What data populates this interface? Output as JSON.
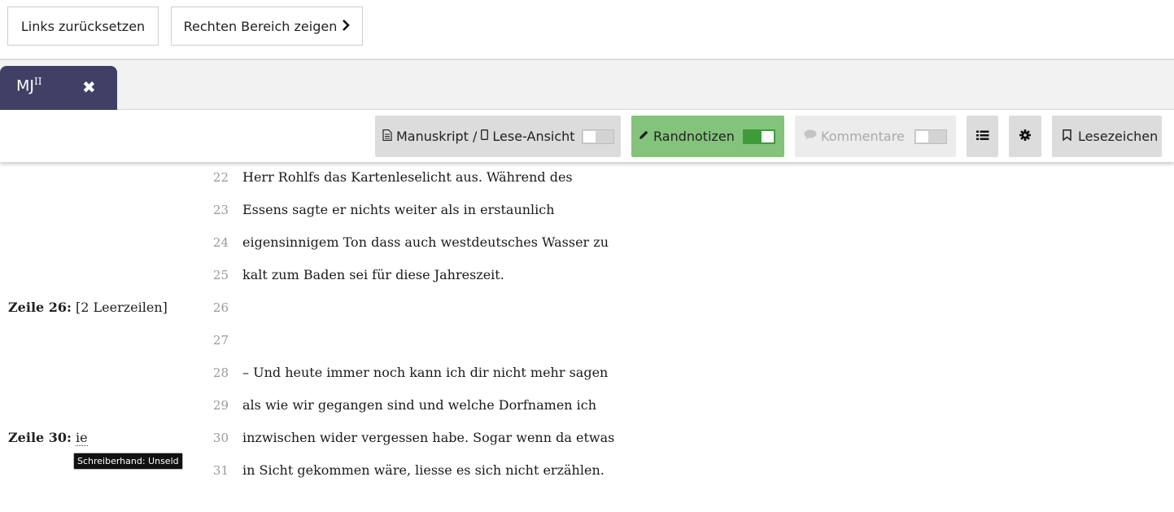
{
  "top_buttons": {
    "reset_left": "Links zurücksetzen",
    "show_right": "Rechten Bereich zeigen"
  },
  "tab": {
    "label": "MJ",
    "sup": "II",
    "close": "✖"
  },
  "toolbar": {
    "view_toggle": {
      "manuscript_label": "Manuskript /",
      "reading_label": "Lese-Ansicht",
      "on": false
    },
    "notes_toggle": {
      "label": "Randnotizen",
      "on": true
    },
    "comments_toggle": {
      "label": "Kommentare",
      "on": false,
      "disabled": true
    },
    "list_icon": "list-icon",
    "settings_icon": "gear-icon",
    "bookmarks_label": "Lesezeichen"
  },
  "lines": [
    {
      "num": "22",
      "text": "Herr Rohlfs das Kartenleselicht aus. Während des",
      "note_label": "",
      "note_text": ""
    },
    {
      "num": "23",
      "text": "Essens sagte er nichts weiter als in erstaunlich",
      "note_label": "",
      "note_text": ""
    },
    {
      "num": "24",
      "text": "eigensinnigem Ton dass auch westdeutsches Wasser zu",
      "note_label": "",
      "note_text": ""
    },
    {
      "num": "25",
      "text": "kalt zum Baden sei für diese Jahreszeit.",
      "note_label": "",
      "note_text": ""
    },
    {
      "num": "26",
      "text": "",
      "note_label": "Zeile 26:",
      "note_text": "[2 Leerzeilen]"
    },
    {
      "num": "27",
      "text": "",
      "note_label": "",
      "note_text": ""
    },
    {
      "num": "28",
      "text": "– Und heute immer noch kann ich dir nicht mehr sagen",
      "note_label": "",
      "note_text": ""
    },
    {
      "num": "29",
      "text": "als wie wir gegangen sind und welche Dorfnamen ich",
      "note_label": "",
      "note_text": ""
    },
    {
      "num": "30",
      "text": "inzwischen wider vergessen habe. Sogar wenn da etwas",
      "note_label": "Zeile 30:",
      "note_text": "ie"
    },
    {
      "num": "31",
      "text": "in Sicht gekommen wäre, liesse es sich nicht erzählen.",
      "note_label": "",
      "note_text": ""
    }
  ],
  "tooltip": "Schreiberhand: Unseld",
  "colors": {
    "tab_bg": "#403f66",
    "notes_active": "#84c37b",
    "toggle_on": "#3f9b3a"
  }
}
